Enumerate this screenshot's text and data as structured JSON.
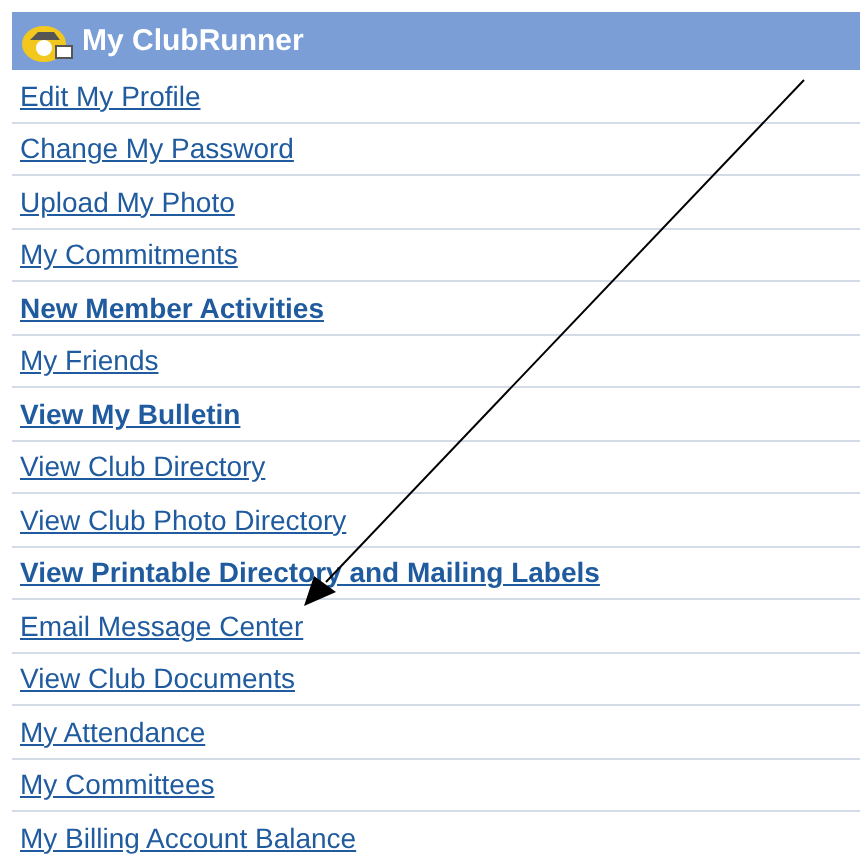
{
  "panel": {
    "title": "My ClubRunner"
  },
  "links": [
    {
      "label": "Edit My Profile",
      "bold": false
    },
    {
      "label": "Change My Password",
      "bold": false
    },
    {
      "label": "Upload My Photo",
      "bold": false
    },
    {
      "label": "My Commitments",
      "bold": false
    },
    {
      "label": "New Member Activities",
      "bold": true
    },
    {
      "label": "My Friends",
      "bold": false
    },
    {
      "label": "View My Bulletin",
      "bold": true
    },
    {
      "label": "View Club Directory",
      "bold": false
    },
    {
      "label": "View Club Photo Directory",
      "bold": false
    },
    {
      "label": "View Printable Directory and Mailing Labels",
      "bold": true
    },
    {
      "label": "Email Message Center",
      "bold": false
    },
    {
      "label": "View Club Documents",
      "bold": false
    },
    {
      "label": "My Attendance",
      "bold": false
    },
    {
      "label": "My Committees",
      "bold": false
    },
    {
      "label": "My Billing Account Balance",
      "bold": false
    }
  ]
}
